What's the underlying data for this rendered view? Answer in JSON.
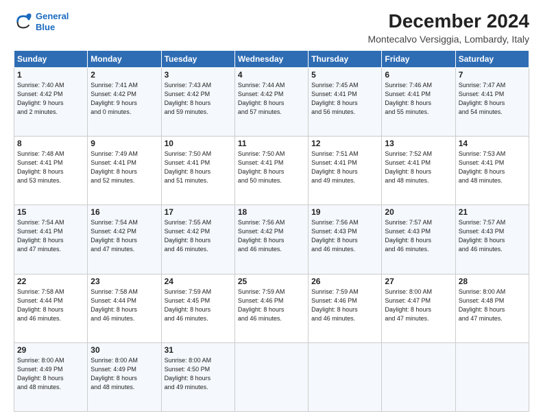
{
  "logo": {
    "line1": "General",
    "line2": "Blue"
  },
  "title": "December 2024",
  "subtitle": "Montecalvo Versiggia, Lombardy, Italy",
  "days_header": [
    "Sunday",
    "Monday",
    "Tuesday",
    "Wednesday",
    "Thursday",
    "Friday",
    "Saturday"
  ],
  "weeks": [
    [
      {
        "day": "1",
        "info": "Sunrise: 7:40 AM\nSunset: 4:42 PM\nDaylight: 9 hours\nand 2 minutes."
      },
      {
        "day": "2",
        "info": "Sunrise: 7:41 AM\nSunset: 4:42 PM\nDaylight: 9 hours\nand 0 minutes."
      },
      {
        "day": "3",
        "info": "Sunrise: 7:43 AM\nSunset: 4:42 PM\nDaylight: 8 hours\nand 59 minutes."
      },
      {
        "day": "4",
        "info": "Sunrise: 7:44 AM\nSunset: 4:42 PM\nDaylight: 8 hours\nand 57 minutes."
      },
      {
        "day": "5",
        "info": "Sunrise: 7:45 AM\nSunset: 4:41 PM\nDaylight: 8 hours\nand 56 minutes."
      },
      {
        "day": "6",
        "info": "Sunrise: 7:46 AM\nSunset: 4:41 PM\nDaylight: 8 hours\nand 55 minutes."
      },
      {
        "day": "7",
        "info": "Sunrise: 7:47 AM\nSunset: 4:41 PM\nDaylight: 8 hours\nand 54 minutes."
      }
    ],
    [
      {
        "day": "8",
        "info": "Sunrise: 7:48 AM\nSunset: 4:41 PM\nDaylight: 8 hours\nand 53 minutes."
      },
      {
        "day": "9",
        "info": "Sunrise: 7:49 AM\nSunset: 4:41 PM\nDaylight: 8 hours\nand 52 minutes."
      },
      {
        "day": "10",
        "info": "Sunrise: 7:50 AM\nSunset: 4:41 PM\nDaylight: 8 hours\nand 51 minutes."
      },
      {
        "day": "11",
        "info": "Sunrise: 7:50 AM\nSunset: 4:41 PM\nDaylight: 8 hours\nand 50 minutes."
      },
      {
        "day": "12",
        "info": "Sunrise: 7:51 AM\nSunset: 4:41 PM\nDaylight: 8 hours\nand 49 minutes."
      },
      {
        "day": "13",
        "info": "Sunrise: 7:52 AM\nSunset: 4:41 PM\nDaylight: 8 hours\nand 48 minutes."
      },
      {
        "day": "14",
        "info": "Sunrise: 7:53 AM\nSunset: 4:41 PM\nDaylight: 8 hours\nand 48 minutes."
      }
    ],
    [
      {
        "day": "15",
        "info": "Sunrise: 7:54 AM\nSunset: 4:41 PM\nDaylight: 8 hours\nand 47 minutes."
      },
      {
        "day": "16",
        "info": "Sunrise: 7:54 AM\nSunset: 4:42 PM\nDaylight: 8 hours\nand 47 minutes."
      },
      {
        "day": "17",
        "info": "Sunrise: 7:55 AM\nSunset: 4:42 PM\nDaylight: 8 hours\nand 46 minutes."
      },
      {
        "day": "18",
        "info": "Sunrise: 7:56 AM\nSunset: 4:42 PM\nDaylight: 8 hours\nand 46 minutes."
      },
      {
        "day": "19",
        "info": "Sunrise: 7:56 AM\nSunset: 4:43 PM\nDaylight: 8 hours\nand 46 minutes."
      },
      {
        "day": "20",
        "info": "Sunrise: 7:57 AM\nSunset: 4:43 PM\nDaylight: 8 hours\nand 46 minutes."
      },
      {
        "day": "21",
        "info": "Sunrise: 7:57 AM\nSunset: 4:43 PM\nDaylight: 8 hours\nand 46 minutes."
      }
    ],
    [
      {
        "day": "22",
        "info": "Sunrise: 7:58 AM\nSunset: 4:44 PM\nDaylight: 8 hours\nand 46 minutes."
      },
      {
        "day": "23",
        "info": "Sunrise: 7:58 AM\nSunset: 4:44 PM\nDaylight: 8 hours\nand 46 minutes."
      },
      {
        "day": "24",
        "info": "Sunrise: 7:59 AM\nSunset: 4:45 PM\nDaylight: 8 hours\nand 46 minutes."
      },
      {
        "day": "25",
        "info": "Sunrise: 7:59 AM\nSunset: 4:46 PM\nDaylight: 8 hours\nand 46 minutes."
      },
      {
        "day": "26",
        "info": "Sunrise: 7:59 AM\nSunset: 4:46 PM\nDaylight: 8 hours\nand 46 minutes."
      },
      {
        "day": "27",
        "info": "Sunrise: 8:00 AM\nSunset: 4:47 PM\nDaylight: 8 hours\nand 47 minutes."
      },
      {
        "day": "28",
        "info": "Sunrise: 8:00 AM\nSunset: 4:48 PM\nDaylight: 8 hours\nand 47 minutes."
      }
    ],
    [
      {
        "day": "29",
        "info": "Sunrise: 8:00 AM\nSunset: 4:49 PM\nDaylight: 8 hours\nand 48 minutes."
      },
      {
        "day": "30",
        "info": "Sunrise: 8:00 AM\nSunset: 4:49 PM\nDaylight: 8 hours\nand 48 minutes."
      },
      {
        "day": "31",
        "info": "Sunrise: 8:00 AM\nSunset: 4:50 PM\nDaylight: 8 hours\nand 49 minutes."
      },
      {
        "day": "",
        "info": ""
      },
      {
        "day": "",
        "info": ""
      },
      {
        "day": "",
        "info": ""
      },
      {
        "day": "",
        "info": ""
      }
    ]
  ]
}
